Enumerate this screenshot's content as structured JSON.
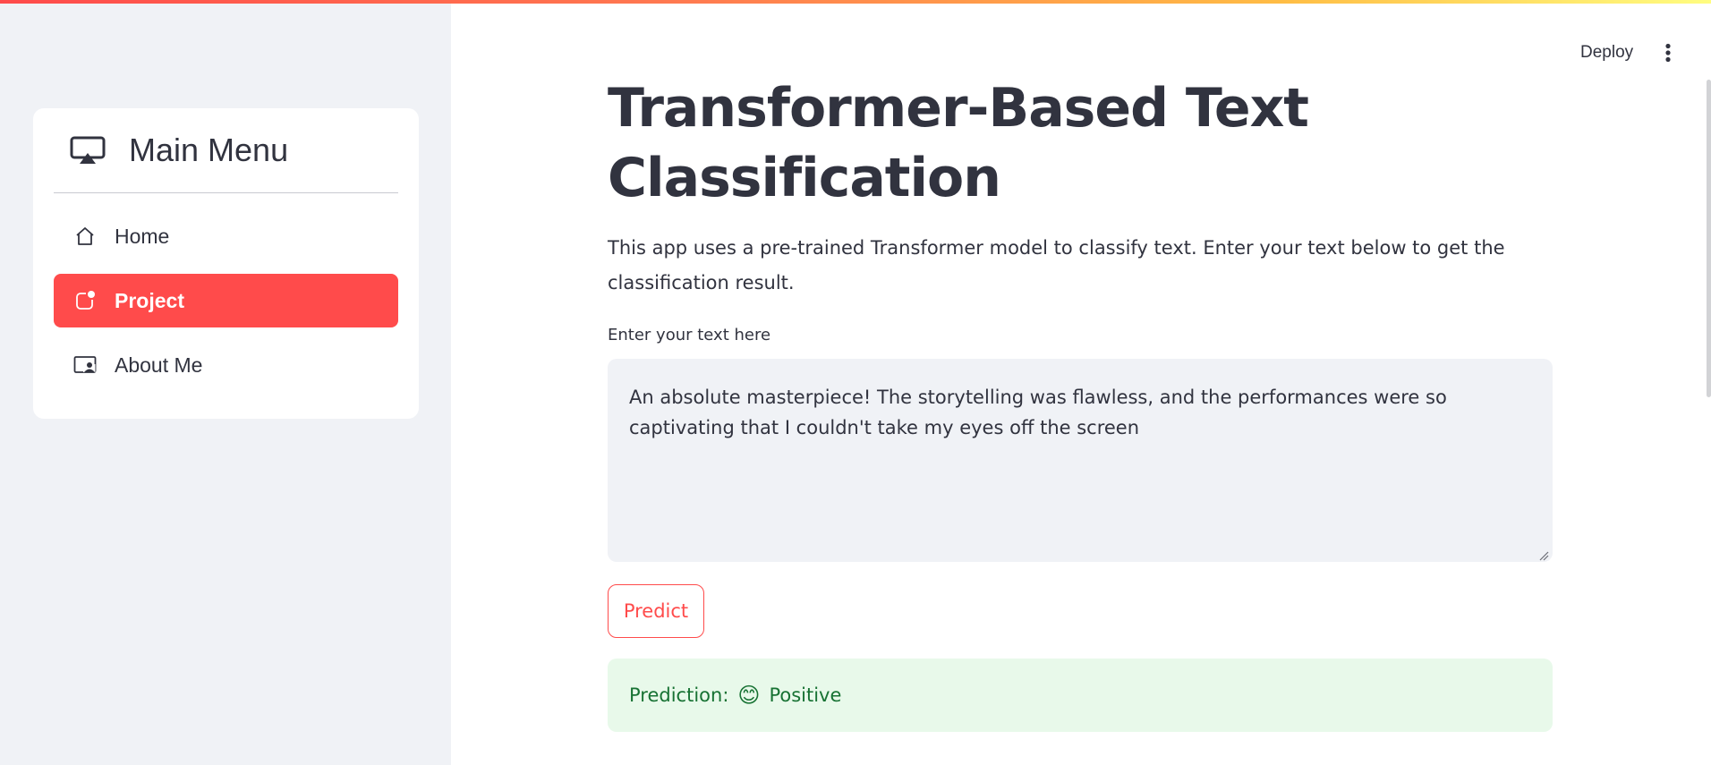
{
  "sidebar": {
    "menu_title": "Main Menu",
    "items": [
      {
        "label": "Home",
        "icon": "house-icon",
        "active": false
      },
      {
        "label": "Project",
        "icon": "app-indicator-icon",
        "active": true
      },
      {
        "label": "About Me",
        "icon": "person-video-icon",
        "active": false
      }
    ]
  },
  "header": {
    "deploy_label": "Deploy",
    "menu_icon": "kebab-menu-icon"
  },
  "main": {
    "title": "Transformer-Based Text Classification",
    "description": "This app uses a pre-trained Transformer model to classify text. Enter your text below to get the classification result.",
    "input_label": "Enter your text here",
    "input_value": "An absolute masterpiece! The storytelling was flawless, and the performances were so captivating that I couldn't take my eyes off the screen",
    "predict_label": "Predict",
    "result_prefix": "Prediction:",
    "result_emoji": "😊",
    "result_label": "Positive"
  },
  "colors": {
    "accent": "#ff4b4b",
    "sidebar_bg": "#f0f2f6",
    "success_bg": "#e8f9ea",
    "success_text": "#177233"
  }
}
